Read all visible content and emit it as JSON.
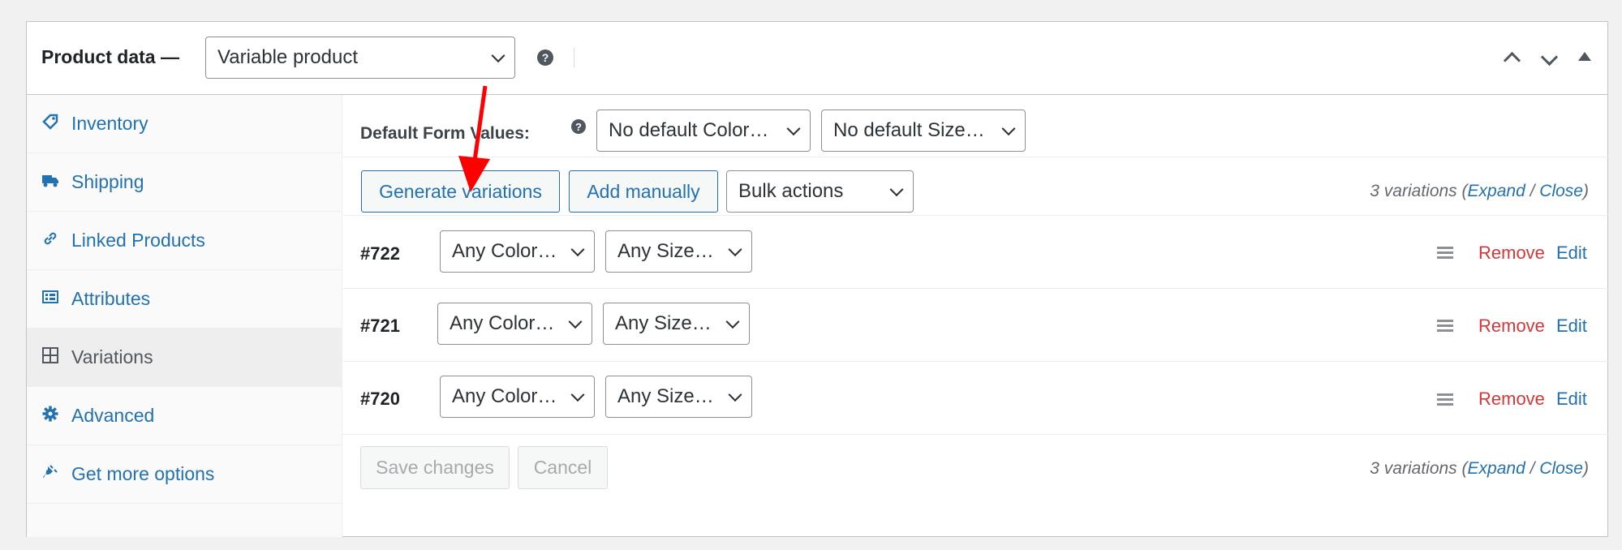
{
  "header": {
    "title": "Product data —",
    "product_type": "Variable product",
    "help": "?"
  },
  "sidebar": {
    "items": [
      {
        "label": "Inventory",
        "icon": "tag-icon"
      },
      {
        "label": "Shipping",
        "icon": "truck-icon"
      },
      {
        "label": "Linked Products",
        "icon": "link-icon"
      },
      {
        "label": "Attributes",
        "icon": "list-icon"
      },
      {
        "label": "Variations",
        "icon": "grid-icon",
        "active": true
      },
      {
        "label": "Advanced",
        "icon": "gear-icon"
      },
      {
        "label": "Get more options",
        "icon": "plugin-icon"
      }
    ]
  },
  "defaults": {
    "label": "Default Form Values:",
    "help": "?",
    "color_select": "No default Color…",
    "size_select": "No default Size…"
  },
  "toolbar": {
    "generate": "Generate variations",
    "add_manually": "Add manually",
    "bulk_actions": "Bulk actions",
    "count": "3 variations",
    "open_paren": "(",
    "expand": "Expand",
    "slash": "/",
    "close": "Close",
    "close_paren": ")"
  },
  "variations": [
    {
      "id": "#722",
      "color": "Any Color…",
      "size": "Any Size…",
      "remove": "Remove",
      "edit": "Edit"
    },
    {
      "id": "#721",
      "color": "Any Color…",
      "size": "Any Size…",
      "remove": "Remove",
      "edit": "Edit"
    },
    {
      "id": "#720",
      "color": "Any Color…",
      "size": "Any Size…",
      "remove": "Remove",
      "edit": "Edit"
    }
  ],
  "footer": {
    "save": "Save changes",
    "cancel": "Cancel",
    "count": "3 variations",
    "open_paren": "(",
    "expand": "Expand",
    "slash": "/",
    "close": "Close",
    "close_paren": ")"
  },
  "colors": {
    "link": "#2271b1",
    "remove": "#d63638",
    "annotation_arrow": "#ff0000"
  }
}
